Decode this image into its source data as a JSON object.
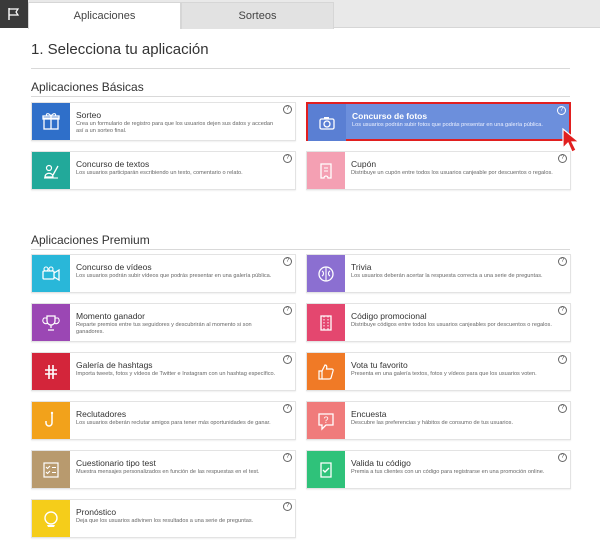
{
  "tabs": [
    {
      "label": "Aplicaciones"
    },
    {
      "label": "Sorteos"
    }
  ],
  "page_title": "1. Selecciona tu aplicación",
  "help_glyph": "?",
  "basic": {
    "title": "Aplicaciones Básicas",
    "apps": [
      {
        "name": "Sorteo",
        "desc": "Crea un formulario de registro para que los usuarios dejen sus datos y accedan así a un sorteo final.",
        "color": "#2f6fc9",
        "icon": "gift-icon"
      },
      {
        "name": "Concurso de fotos",
        "desc": "Los usuarios podrán subir fotos que podrás presentar en una galería pública.",
        "color": "#5a7fd3",
        "icon": "camera-icon",
        "selected": true
      },
      {
        "name": "Concurso de textos",
        "desc": "Los usuarios participarán escribiendo un texto, comentario o relato.",
        "color": "#22a99a",
        "icon": "writer-icon"
      },
      {
        "name": "Cupón",
        "desc": "Distribuye un cupón entre todos los usuarios canjeable por descuentos o regalos.",
        "color": "#f4a0b3",
        "icon": "coupon-icon"
      }
    ]
  },
  "premium": {
    "title": "Aplicaciones Premium",
    "apps": [
      {
        "name": "Concurso de vídeos",
        "desc": "Los usuarios podrán subir vídeos que podrás presentar en una galería pública.",
        "color": "#29b7d9",
        "icon": "video-camera-icon"
      },
      {
        "name": "Trivia",
        "desc": "Los usuarios deberán acertar la respuesta correcta a una serie de preguntas.",
        "color": "#8b6fd1",
        "icon": "brain-icon"
      },
      {
        "name": "Momento ganador",
        "desc": "Reparte premios entre tus seguidores y descubrirán al momento si son ganadores.",
        "color": "#9b47b4",
        "icon": "trophy-icon"
      },
      {
        "name": "Código promocional",
        "desc": "Distribuye códigos entre todos los usuarios canjeables por descuentos o regalos.",
        "color": "#e4476f",
        "icon": "ticket-icon"
      },
      {
        "name": "Galería de hashtags",
        "desc": "Importa tweets, fotos y vídeos de Twitter e Instagram con un hashtag específico.",
        "color": "#d3253a",
        "icon": "hashtag-icon"
      },
      {
        "name": "Vota tu favorito",
        "desc": "Presenta en una galería textos, fotos y vídeos para que los usuarios voten.",
        "color": "#f07a26",
        "icon": "thumbs-up-icon"
      },
      {
        "name": "Reclutadores",
        "desc": "Los usuarios deberán reclutar amigos para tener más oportunidades de ganar.",
        "color": "#f2a21b",
        "icon": "hook-icon"
      },
      {
        "name": "Encuesta",
        "desc": "Descubre las preferencias y hábitos de consumo de tus usuarios.",
        "color": "#f07b7b",
        "icon": "question-bubble-icon"
      },
      {
        "name": "Cuestionario tipo test",
        "desc": "Muestra mensajes personalizados en función de las respuestas en el test.",
        "color": "#b89a6e",
        "icon": "checklist-icon"
      },
      {
        "name": "Valida tu código",
        "desc": "Premia a tus clientes con un código para registrarse en una promoción online.",
        "color": "#2fc27a",
        "icon": "validate-code-icon"
      },
      {
        "name": "Pronóstico",
        "desc": "Deja que los usuarios adivinen los resultados a una serie de preguntas.",
        "color": "#f5cd1a",
        "icon": "crystal-ball-icon"
      }
    ]
  }
}
